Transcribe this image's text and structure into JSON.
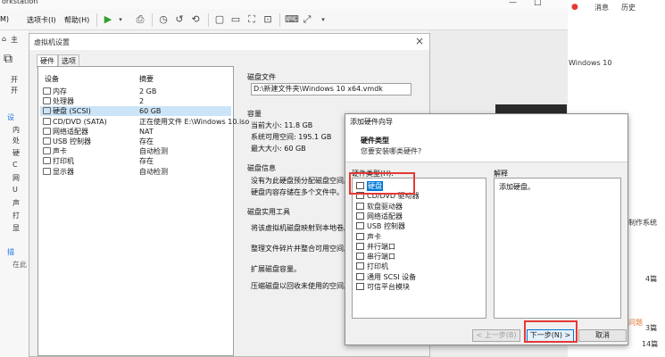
{
  "workstation": {
    "title": "orkstation",
    "window_buttons": [
      "—",
      "□"
    ],
    "menus": [
      "M)",
      "选项卡(I)",
      "帮助(H)"
    ],
    "left_items": [
      "主",
      "开",
      "开",
      "设",
      "内",
      "处",
      "硬",
      "C",
      "网",
      "U",
      "声",
      "打",
      "显",
      "描",
      "在此"
    ]
  },
  "vm_dialog": {
    "title": "虚拟机设置",
    "close": "×",
    "tabs": [
      "硬件",
      "选项"
    ],
    "columns": {
      "device": "设备",
      "summary": "摘要"
    },
    "devices": [
      {
        "name": "内存",
        "summary": "2 GB",
        "icon": "memory-icon"
      },
      {
        "name": "处理器",
        "summary": "2",
        "icon": "processor-icon"
      },
      {
        "name": "硬盘 (SCSI)",
        "summary": "60 GB",
        "icon": "harddisk-icon",
        "selected": true
      },
      {
        "name": "CD/DVD (SATA)",
        "summary": "正在使用文件 E:\\Windows 10.iso",
        "icon": "cd-icon"
      },
      {
        "name": "网络适配器",
        "summary": "NAT",
        "icon": "network-icon"
      },
      {
        "name": "USB 控制器",
        "summary": "存在",
        "icon": "usb-icon"
      },
      {
        "name": "声卡",
        "summary": "自动检测",
        "icon": "sound-icon"
      },
      {
        "name": "打印机",
        "summary": "存在",
        "icon": "printer-icon"
      },
      {
        "name": "显示器",
        "summary": "自动检测",
        "icon": "display-icon"
      }
    ],
    "disk_file": {
      "label": "磁盘文件",
      "value": "D:\\新建文件夹\\Windows 10 x64.vmdk"
    },
    "capacity": {
      "label": "容量",
      "current": "当前大小: 11.8 GB",
      "free": "系统可用空间: 195.1 GB",
      "max": "最大大小: 60 GB"
    },
    "disk_info": {
      "label": "磁盘信息",
      "line1": "没有为此硬盘预分配磁盘空间。",
      "line2": "硬盘内容存储在多个文件中。"
    },
    "disk_utils": {
      "label": "磁盘实用工具",
      "items": [
        "将该虚拟机磁盘映射到本地卷。",
        "整理文件碎片并整合可用空间。",
        "扩展磁盘容量。",
        "压缩磁盘以回收未使用的空间。"
      ]
    }
  },
  "wizard": {
    "title": "添加硬件向导",
    "header_title": "硬件类型",
    "header_subtitle": "您要安装哪类硬件?",
    "list_label": "硬件类型(H):",
    "hardware": [
      {
        "name": "硬盘",
        "selected": true,
        "icon": "harddisk-icon"
      },
      {
        "name": "CD/DVD 驱动器",
        "icon": "cd-icon"
      },
      {
        "name": "软盘驱动器",
        "icon": "floppy-icon"
      },
      {
        "name": "网络适配器",
        "icon": "network-icon"
      },
      {
        "name": "USB 控制器",
        "icon": "usb-icon"
      },
      {
        "name": "声卡",
        "icon": "sound-icon"
      },
      {
        "name": "并行端口",
        "icon": "parallel-port-icon"
      },
      {
        "name": "串行端口",
        "icon": "serial-port-icon"
      },
      {
        "name": "打印机",
        "icon": "printer-icon"
      },
      {
        "name": "通用 SCSI 设备",
        "icon": "scsi-icon"
      },
      {
        "name": "可信平台模块",
        "icon": "tpm-icon"
      }
    ],
    "desc_label": "解释",
    "description": "添加硬盘。",
    "buttons": {
      "back": "< 上一步(B)",
      "next": "下一步(N) >",
      "cancel": "取消"
    }
  },
  "browser": {
    "nav": [
      "消息",
      "历史"
    ],
    "windows_text": "Windows 10",
    "side_text": "制作系统",
    "counts": [
      "4篇",
      "3篇",
      "14篇"
    ],
    "tag": "问题"
  },
  "colors": {
    "accent": "#0078d7",
    "highlight": "#e53935",
    "selection": "#cce4f7"
  }
}
